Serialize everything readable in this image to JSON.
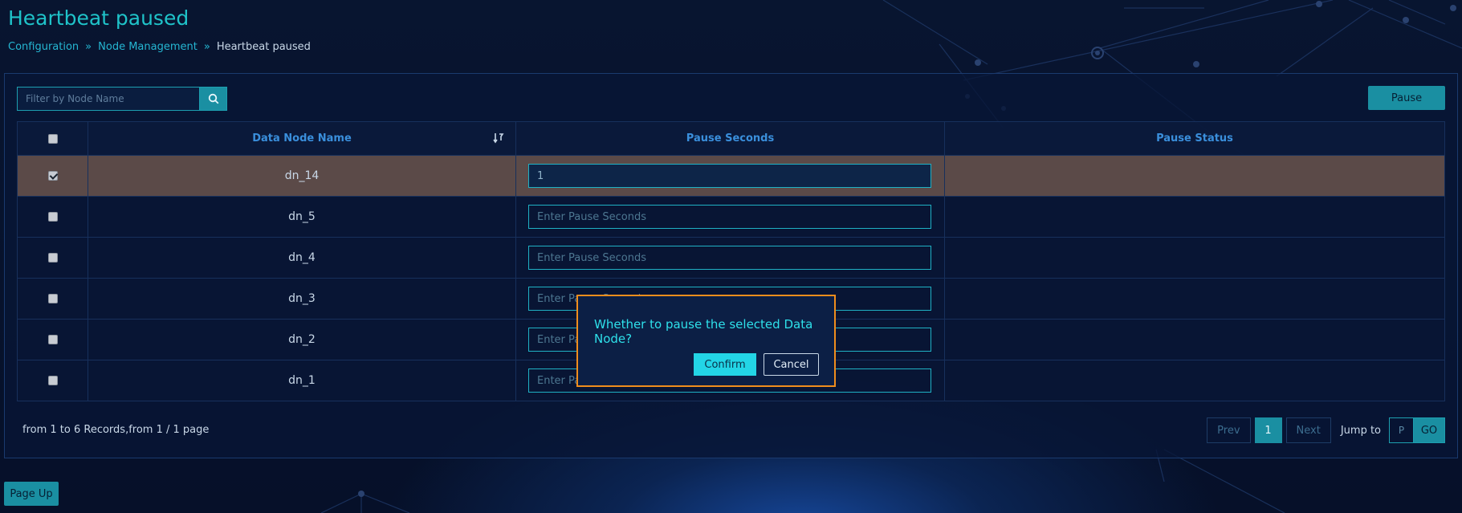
{
  "page": {
    "title": "Heartbeat paused"
  },
  "breadcrumb": {
    "items": [
      "Configuration",
      "Node Management",
      "Heartbeat paused"
    ]
  },
  "toolbar": {
    "search_placeholder": "Filter by Node Name",
    "pause_label": "Pause"
  },
  "table": {
    "headers": {
      "name": "Data Node Name",
      "seconds": "Pause Seconds",
      "status": "Pause Status"
    },
    "seconds_placeholder": "Enter Pause Seconds",
    "rows": [
      {
        "name": "dn_14",
        "seconds": "1",
        "status": "",
        "checked": true
      },
      {
        "name": "dn_5",
        "seconds": "",
        "status": "",
        "checked": false
      },
      {
        "name": "dn_4",
        "seconds": "",
        "status": "",
        "checked": false
      },
      {
        "name": "dn_3",
        "seconds": "",
        "status": "",
        "checked": false
      },
      {
        "name": "dn_2",
        "seconds": "",
        "status": "",
        "checked": false
      },
      {
        "name": "dn_1",
        "seconds": "",
        "status": "",
        "checked": false
      }
    ]
  },
  "footer": {
    "records_text": "from 1 to 6 Records,from 1 / 1 page",
    "prev_label": "Prev",
    "current_page": "1",
    "next_label": "Next",
    "jump_label": "Jump to",
    "jump_placeholder": "P",
    "go_label": "GO"
  },
  "page_up_label": "Page Up",
  "dialog": {
    "message": "Whether to pause the selected Data Node?",
    "confirm_label": "Confirm",
    "cancel_label": "Cancel"
  },
  "colors": {
    "accent": "#1a8fa2",
    "dialog_border": "#f08d1c",
    "selected_row": "#5b4a48"
  }
}
